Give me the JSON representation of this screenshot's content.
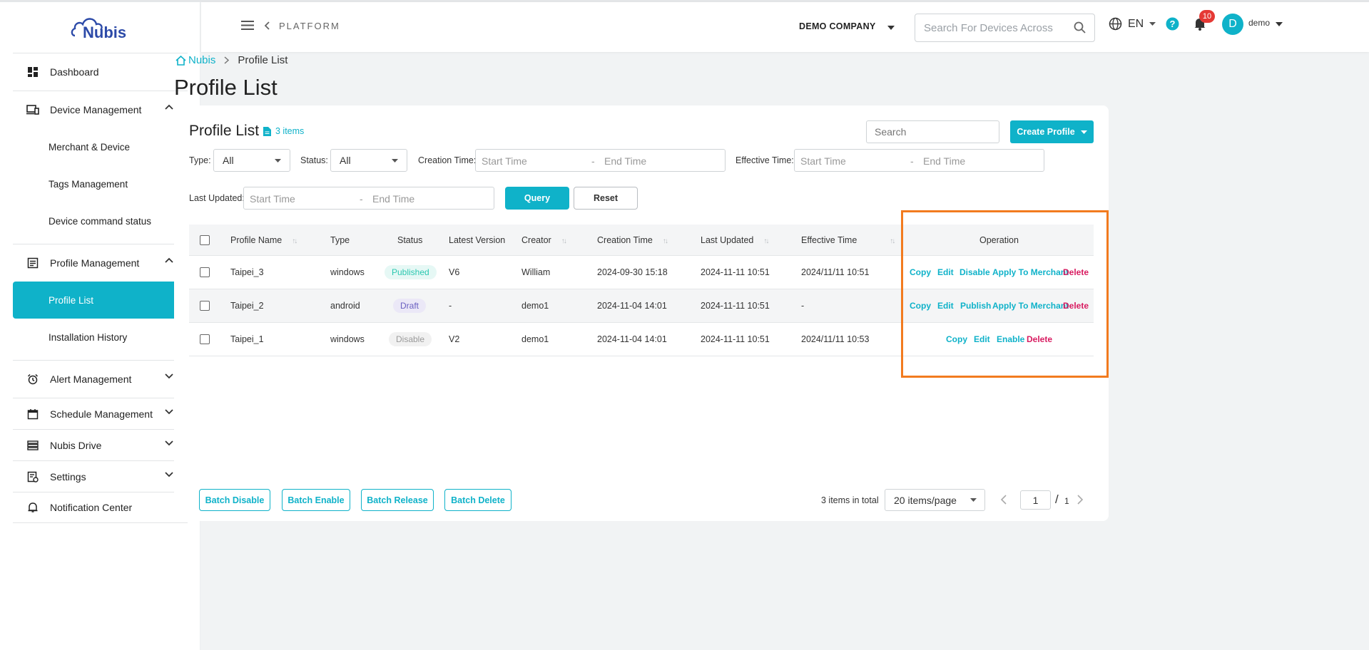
{
  "app": {
    "logo_text": "Nubis"
  },
  "sidebar": {
    "items": [
      {
        "label": "Dashboard",
        "icon": "dashboard-icon"
      },
      {
        "label": "Device Management",
        "icon": "devices-icon",
        "expanded": true,
        "children": [
          "Merchant & Device",
          "Tags Management",
          "Device command status"
        ]
      },
      {
        "label": "Profile Management",
        "icon": "profile-icon",
        "expanded": true,
        "children": [
          "Profile List",
          "Installation History"
        ]
      },
      {
        "label": "Alert Management",
        "icon": "alarm-icon",
        "expanded": false
      },
      {
        "label": "Schedule Management",
        "icon": "calendar-icon",
        "expanded": false
      },
      {
        "label": "Nubis Drive",
        "icon": "drive-icon",
        "expanded": false
      },
      {
        "label": "Settings",
        "icon": "settings-icon",
        "expanded": false
      },
      {
        "label": "Notification Center",
        "icon": "bell-outline-icon"
      }
    ],
    "active": "Profile List"
  },
  "header": {
    "platform": "PLATFORM",
    "company": "DEMO COMPANY",
    "search_placeholder": "Search For Devices Across",
    "language": "EN",
    "notifications": "10",
    "avatar_letter": "D",
    "username": "demo"
  },
  "breadcrumb": {
    "home": "Nubis",
    "current": "Profile List"
  },
  "page": {
    "title": "Profile List"
  },
  "card": {
    "title": "Profile List",
    "count": "3 items",
    "search_placeholder": "Search",
    "create_label": "Create Profile"
  },
  "filters": {
    "type_label": "Type:",
    "type_value": "All",
    "status_label": "Status:",
    "status_value": "All",
    "creation_label": "Creation Time:",
    "effective_label": "Effective Time:",
    "updated_label": "Last Updated:",
    "start_placeholder": "Start Time",
    "end_placeholder": "End Time",
    "dash": "-",
    "query_label": "Query",
    "reset_label": "Reset"
  },
  "table": {
    "headers": {
      "name": "Profile Name",
      "type": "Type",
      "status": "Status",
      "version": "Latest Version",
      "creator": "Creator",
      "created": "Creation Time",
      "updated": "Last Updated",
      "effective": "Effective Time",
      "operation": "Operation"
    },
    "rows": [
      {
        "name": "Taipei_3",
        "type": "windows",
        "status": "Published",
        "version": "V6",
        "creator": "William",
        "created": "2024-09-30 15:18",
        "updated": "2024-11-11 10:51",
        "effective": "2024/11/11 10:51",
        "ops": [
          "Copy",
          "Edit",
          "Disable",
          "Apply To Merchant",
          "Delete"
        ]
      },
      {
        "name": "Taipei_2",
        "type": "android",
        "status": "Draft",
        "version": "-",
        "creator": "demo1",
        "created": "2024-11-04 14:01",
        "updated": "2024-11-11 10:51",
        "effective": "-",
        "ops": [
          "Copy",
          "Edit",
          "Publish",
          "Apply To Merchant",
          "Delete"
        ]
      },
      {
        "name": "Taipei_1",
        "type": "windows",
        "status": "Disable",
        "version": "V2",
        "creator": "demo1",
        "created": "2024-11-04 14:01",
        "updated": "2024-11-11 10:51",
        "effective": "2024/11/11 10:53",
        "ops": [
          "Copy",
          "Edit",
          "Enable",
          "Delete"
        ]
      }
    ]
  },
  "footer": {
    "batch": [
      "Batch Disable",
      "Batch Enable",
      "Batch Release",
      "Batch Delete"
    ],
    "total": "3 items in total",
    "page_size": "20 items/page",
    "page": "1",
    "slash": "/",
    "pages": "1"
  },
  "colors": {
    "accent": "#0fb2c9",
    "danger": "#d81b60",
    "highlight": "#f27b1f"
  }
}
